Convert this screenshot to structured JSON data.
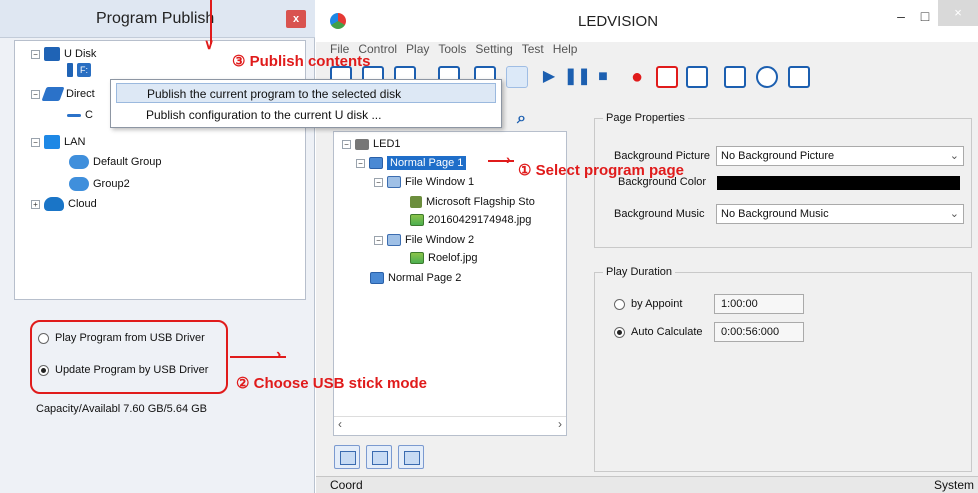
{
  "left_panel": {
    "title": "Program Publish",
    "close": "x",
    "tree": {
      "udisk": "U Disk",
      "udisk_child": "F:",
      "direct": "Direct",
      "direct_child": "C",
      "lan": "LAN",
      "default_group": "Default Group",
      "group2": "Group2",
      "cloud": "Cloud"
    },
    "modes": {
      "play": "Play Program from USB Driver",
      "update": "Update Program by USB Driver",
      "selected": "update"
    },
    "capacity": "Capacity/Availabl 7.60 GB/5.64 GB"
  },
  "right_window": {
    "title": "LEDVISION",
    "controls": {
      "minimize": "–",
      "maximize": "□",
      "close": "×"
    },
    "menu": [
      "File",
      "Control",
      "Play",
      "Tools",
      "Setting",
      "Test",
      "Help"
    ],
    "context_menu": [
      "Publish the current program to the selected disk",
      "Publish configuration to the current U disk ..."
    ],
    "program_tree": {
      "root": "LED1",
      "page1": "Normal Page 1",
      "window1": "File Window 1",
      "item1": "Microsoft Flagship Sto",
      "item2": "20160429174948.jpg",
      "window2": "File Window 2",
      "item3": "Roelof.jpg",
      "page2": "Normal Page 2"
    },
    "page_properties": {
      "group_title": "Page Properties",
      "bg_picture_label": "Background Picture",
      "bg_picture_value": "No Background Picture",
      "bg_color_label": "Background Color",
      "bg_color": "#000000",
      "bg_music_label": "Background Music",
      "bg_music_value": "No Background Music"
    },
    "play_duration": {
      "group_title": "Play Duration",
      "by_appoint_label": "by Appoint",
      "by_appoint_value": "1:00:00",
      "auto_label": "Auto Calculate",
      "auto_value": "0:00:56:000",
      "selected": "auto"
    },
    "status": {
      "left": "Coord",
      "right": "System"
    }
  },
  "annotations": {
    "step1": "① Select program page",
    "step2": "② Choose USB stick mode",
    "step3": "③ Publish contents",
    "color": "#e01b1b"
  }
}
